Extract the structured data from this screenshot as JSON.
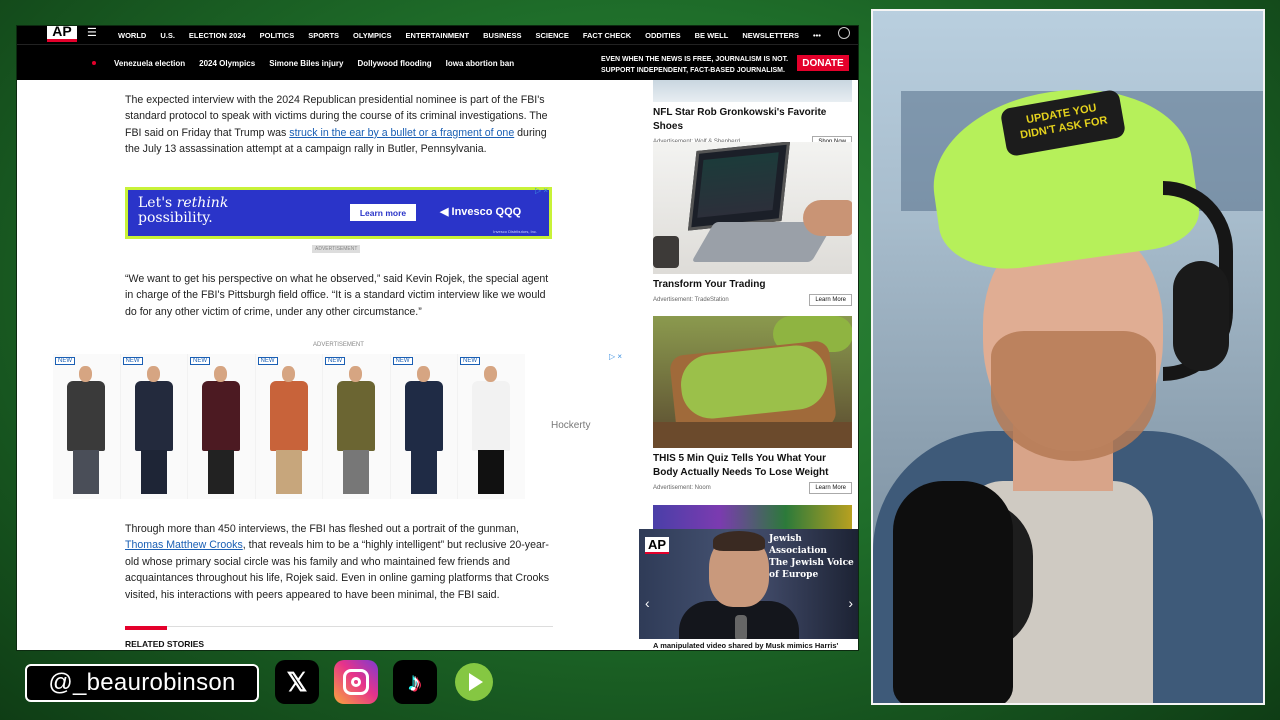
{
  "nav": {
    "logo": "AP",
    "items": [
      "WORLD",
      "U.S.",
      "ELECTION 2024",
      "POLITICS",
      "SPORTS",
      "OLYMPICS",
      "ENTERTAINMENT",
      "BUSINESS",
      "SCIENCE",
      "FACT CHECK",
      "ODDITIES",
      "BE WELL",
      "NEWSLETTERS",
      "•••"
    ]
  },
  "trending": {
    "items": [
      "Venezuela election",
      "2024 Olympics",
      "Simone Biles injury",
      "Dollywood flooding",
      "Iowa abortion ban"
    ],
    "donate_text": "EVEN WHEN THE NEWS IS FREE, JOURNALISM IS NOT. SUPPORT INDEPENDENT, FACT-BASED JOURNALISM.",
    "donate_label": "DONATE"
  },
  "article": {
    "p1_before": "The expected interview with the 2024 Republican presidential nominee is part of the FBI's standard protocol to speak with victims during the course of its criminal investigations. The FBI said on Friday that Trump was ",
    "p1_link": "struck in the ear by a bullet or a fragment of one",
    "p1_after": " during the July 13 assassination attempt at a campaign rally in Butler, Pennsylvania.",
    "p2": "“We want to get his perspective on what he observed,” said Kevin Rojek, the special agent in charge of the FBI's Pittsburgh field office. “It is a standard victim interview like we would do for any other victim of crime, under any other circumstance.”",
    "p3_before": "Through more than 450 interviews, the FBI has fleshed out a portrait of the gunman, ",
    "p3_link": "Thomas Matthew Crooks",
    "p3_after": ", that reveals him to be a “highly intelligent” but reclusive 20-year-old whose primary social circle was his family and who maintained few friends and acquaintances throughout his life, Rojek said. Even in online gaming platforms that Crooks visited, his interactions with peers appeared to have been minimal, the FBI said.",
    "related_label": "RELATED STORIES"
  },
  "ads": {
    "invesco_headline_1": "Let's ",
    "invesco_headline_em": "rethink",
    "invesco_headline_2": "possibility.",
    "invesco_button": "Learn more",
    "invesco_brand": "Invesco QQQ",
    "invesco_disclaimer": "Invesco Distributors, Inc.",
    "advertisement_label_1": "ADVERTISEMENT",
    "advertisement_label_2": "ADVERTISEMENT",
    "hockerty_badge": "NEW",
    "hockerty_label": "Hockerty",
    "ad_choices": "▷ ×"
  },
  "products": [
    {
      "coat": "#3a3a3a",
      "legs": "#4a4e58"
    },
    {
      "coat": "#232a3d",
      "legs": "#1e2536"
    },
    {
      "coat": "#4c1a22",
      "legs": "#222"
    },
    {
      "coat": "#c8633a",
      "legs": "#c7a67c"
    },
    {
      "coat": "#6b6532",
      "legs": "#777"
    },
    {
      "coat": "#1f2b45",
      "legs": "#1f2b45"
    },
    {
      "coat": "#f2f2f2",
      "legs": "#111"
    }
  ],
  "rail": [
    {
      "title": "NFL Star Rob Gronkowski's Favorite Shoes",
      "advertiser": "Advertisement:  Wolf & Shepherd",
      "button": "Shop Now"
    },
    {
      "title": "Transform Your Trading",
      "advertiser": "Advertisement:  TradeStation",
      "button": "Learn More"
    },
    {
      "title": "THIS 5 Min Quiz Tells You What Your Body Actually Needs To Lose Weight",
      "advertiser": "Advertisement:  Noom",
      "button": "Learn More"
    }
  ],
  "video": {
    "logo": "AP",
    "banner": "Jewish Association\nThe Jewish Voice of Europe",
    "caption": "A manipulated video shared by Musk mimics Harris'"
  },
  "webcam": {
    "cap_text": "UPDATE YOU\nDIDN'T ASK FOR"
  },
  "social": {
    "handle": "@_beaurobinson",
    "x_glyph": "𝕏",
    "tiktok_glyph": "♪"
  }
}
